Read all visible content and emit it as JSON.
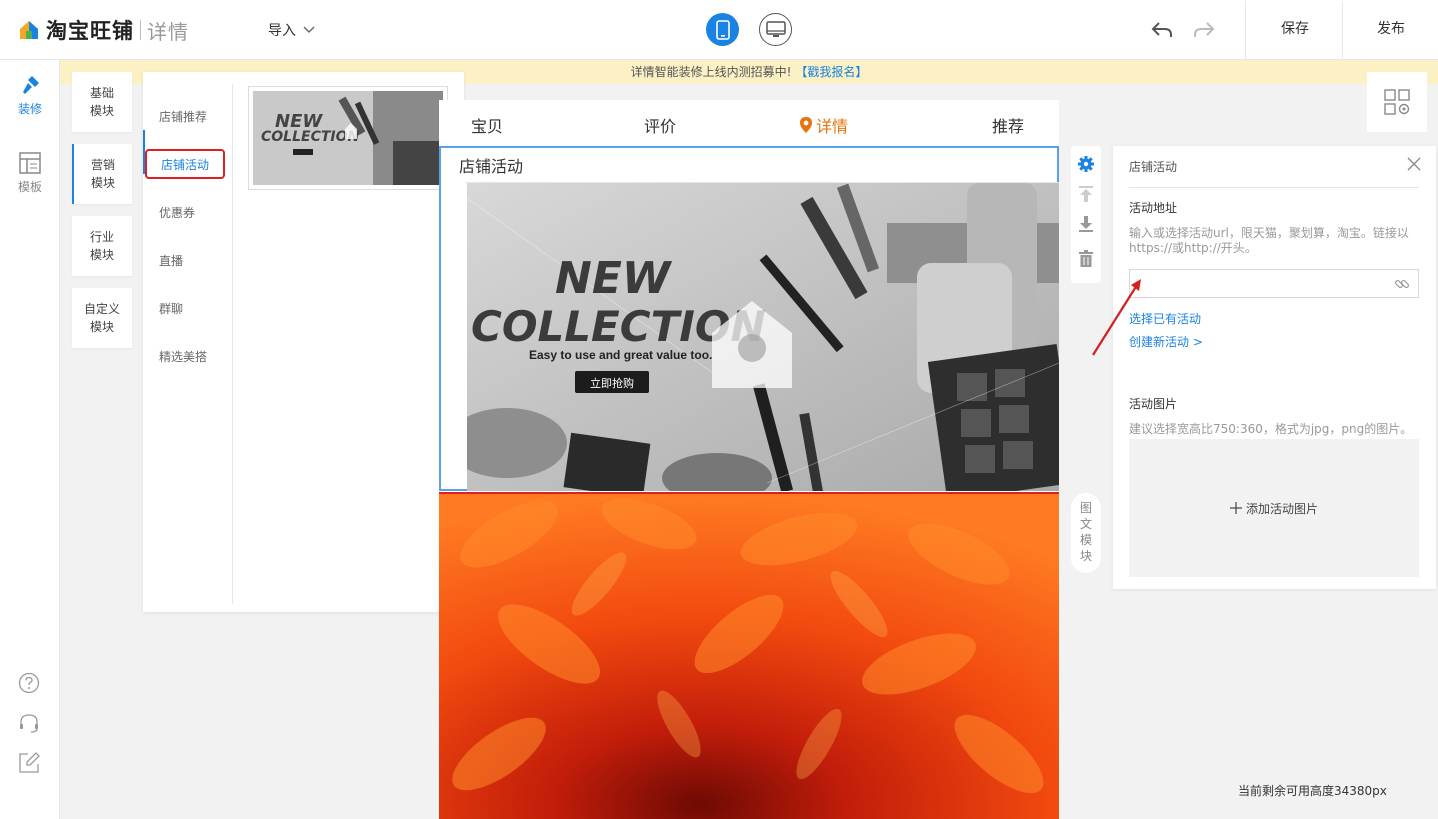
{
  "header": {
    "brand_name": "淘宝旺铺",
    "brand_sub": "详情",
    "import_label": "导入",
    "save_label": "保存",
    "publish_label": "发布"
  },
  "rail": {
    "decorate_label": "装修",
    "template_label": "模板"
  },
  "notice": {
    "text": "详情智能装修上线内测招募中!",
    "link": "【戳我报名】"
  },
  "categories": [
    "基础\n模块",
    "营销\n模块",
    "行业\n模块",
    "自定义\n模块"
  ],
  "modules": {
    "items": [
      "店铺推荐",
      "店铺活动",
      "优惠券",
      "直播",
      "群聊",
      "精选美搭"
    ],
    "active_index": 1
  },
  "phone": {
    "tabs": [
      "宝贝",
      "评价",
      "详情",
      "推荐"
    ],
    "active_tab": "详情",
    "selected_module_title": "店铺活动",
    "banner": {
      "line1": "NEW",
      "line2": "COLLECTION",
      "tagline": "Easy to use and great value too.",
      "cta": "立即抢购"
    }
  },
  "side_tag": "图文模块",
  "settings": {
    "title": "店铺活动",
    "url_label": "活动地址",
    "url_hint": "输入或选择活动url，限天猫，聚划算，淘宝。链接以https://或http://开头。",
    "url_value": "",
    "select_existing": "选择已有活动",
    "create_new": "创建新活动 >",
    "pic_label": "活动图片",
    "pic_hint": "建议选择宽高比750:360，格式为jpg，png的图片。",
    "add_pic": "添加活动图片"
  },
  "footer": {
    "remaining": "当前剩余可用高度34380px"
  },
  "colors": {
    "accent": "#1a82e2",
    "active_tab": "#e8730c",
    "highlight": "#e02020",
    "notice_bg": "#fbf1c4"
  }
}
